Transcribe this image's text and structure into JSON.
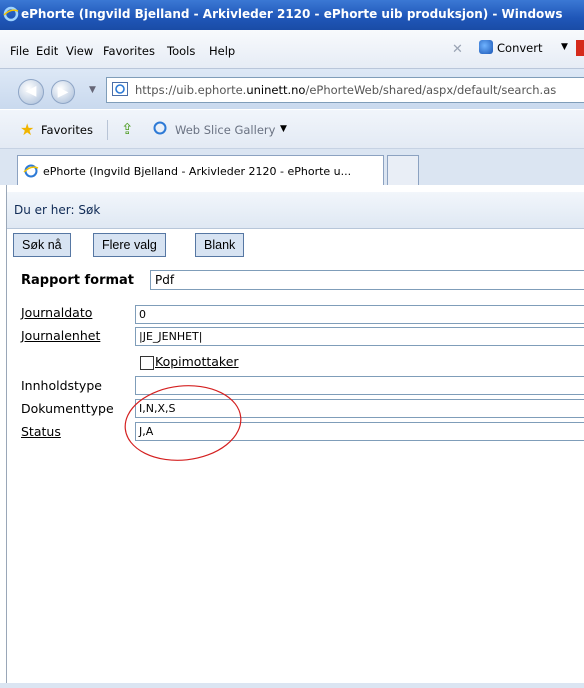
{
  "window": {
    "title": "ePhorte (Ingvild Bjelland - Arkivleder 2120 - ePhorte uib produksjon) - Windows"
  },
  "menu": {
    "items": [
      "File",
      "Edit",
      "View",
      "Favorites",
      "Tools",
      "Help"
    ],
    "convert_label": "Convert"
  },
  "address": {
    "url_prefix": "https://uib.ephorte.",
    "url_host": "uninett.no",
    "url_path": "/ePhorteWeb/shared/aspx/default/search.as"
  },
  "favorites_bar": {
    "favorites_label": "Favorites",
    "web_slice_label": "Web Slice Gallery"
  },
  "tab": {
    "label": "ePhorte (Ingvild Bjelland - Arkivleder 2120 - ePhorte u..."
  },
  "page": {
    "breadcrumb": "Du er her: Søk",
    "buttons": {
      "search": "Søk nå",
      "more_options": "Flere valg",
      "blank": "Blank"
    },
    "report_format": {
      "label": "Rapport format",
      "value": "Pdf"
    },
    "fields": {
      "journaldato": {
        "label": "Journaldato",
        "value": "0"
      },
      "journalenhet": {
        "label": "Journalenhet",
        "value": "|JE_JENHET|"
      },
      "kopimottaker": {
        "label": "Kopimottaker",
        "checked": false
      },
      "innholdstype": {
        "label": "Innholdstype",
        "value": ""
      },
      "dokumenttype": {
        "label": "Dokumenttype",
        "value": "I,N,X,S"
      },
      "status": {
        "label": "Status",
        "value": "J,A"
      }
    }
  },
  "colors": {
    "titlebar": "#1f56b8",
    "annotation_circle": "#d42020"
  }
}
